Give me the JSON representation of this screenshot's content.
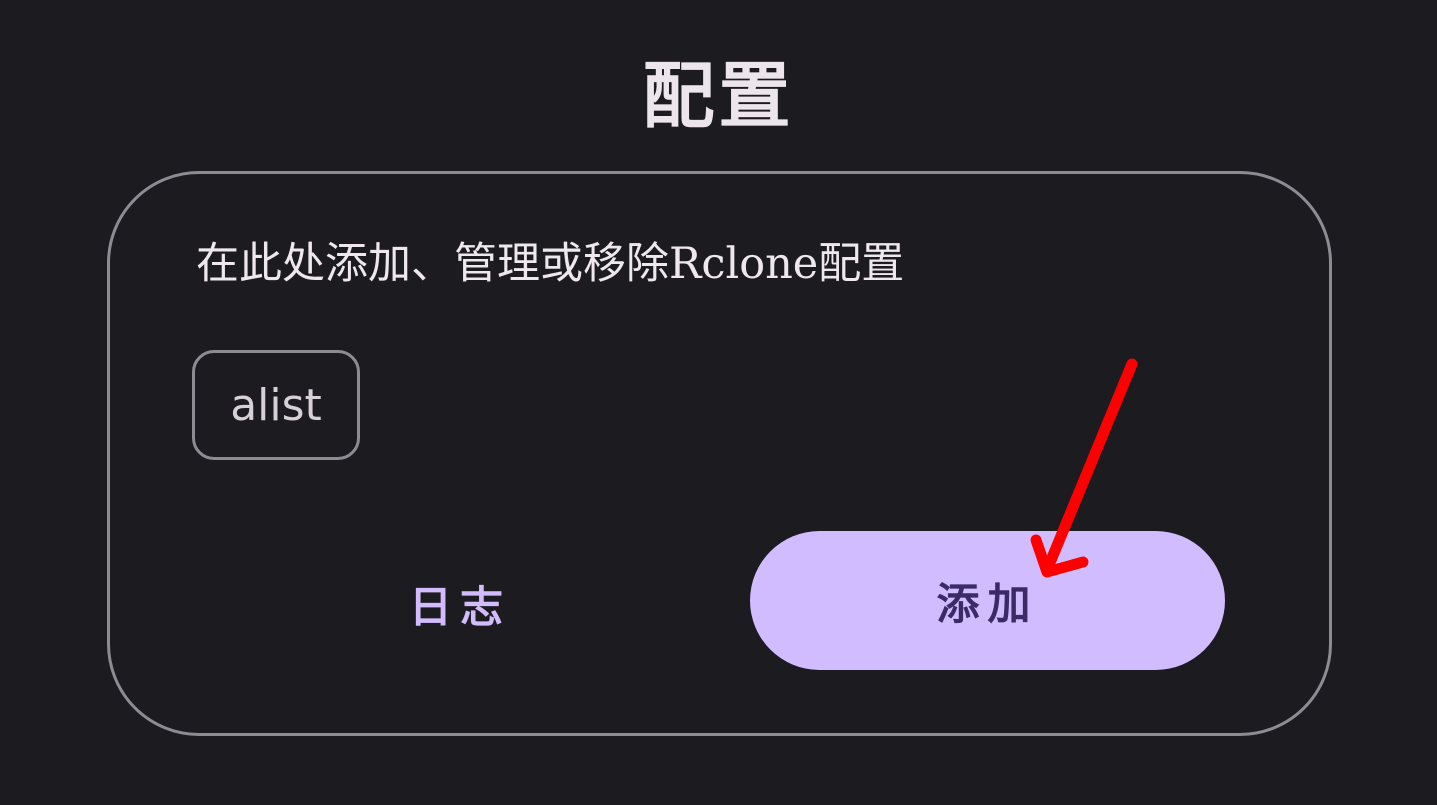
{
  "page": {
    "title": "配置"
  },
  "card": {
    "description": "在此处添加、管理或移除Rclone配置",
    "configs": [
      {
        "label": "alist"
      }
    ],
    "actions": {
      "log_label": "日志",
      "add_label": "添加"
    }
  },
  "colors": {
    "background": "#1c1b20",
    "outline": "#8e8c93",
    "primary": "#d0bcff",
    "on_primary": "#3b2a66",
    "annotation": "#ff0000"
  }
}
